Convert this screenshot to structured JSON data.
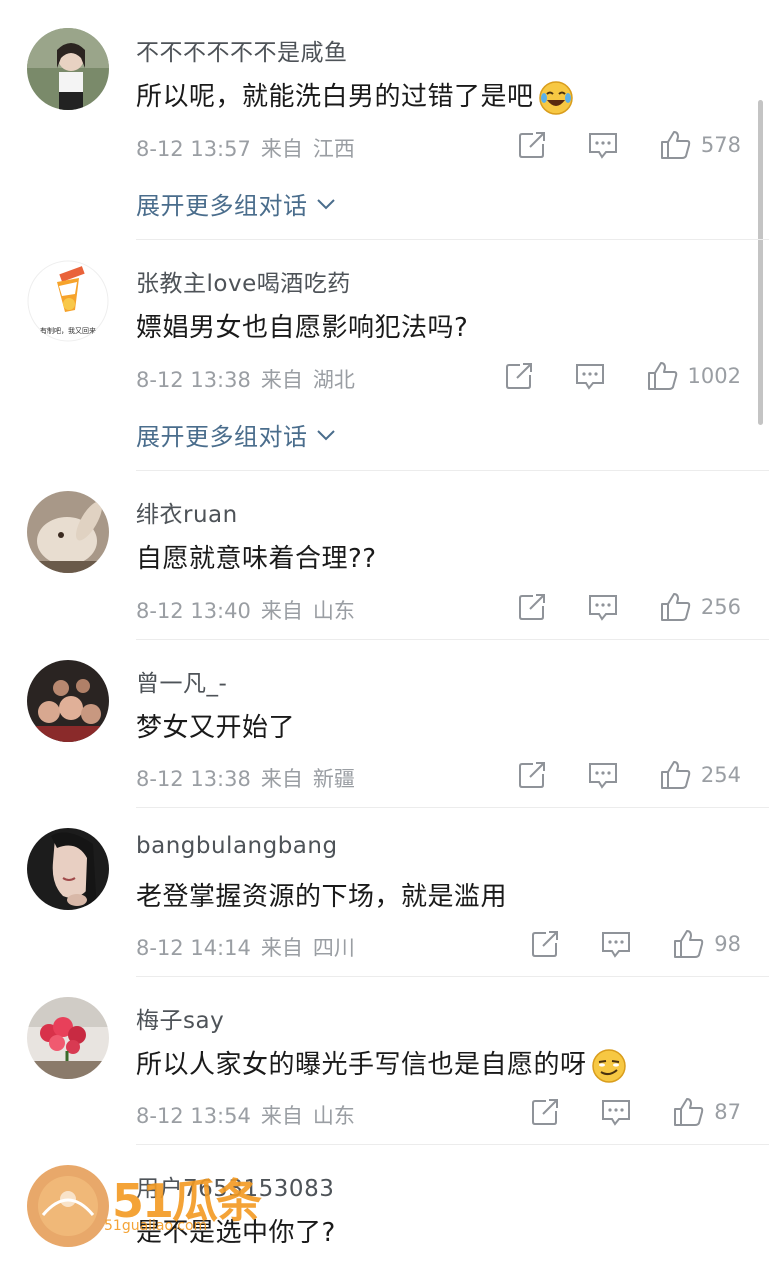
{
  "comments": [
    {
      "username": "不不不不不不是咸鱼",
      "content": "所以呢，就能洗白男的过错了是吧",
      "emoji": "laugh-cry-emoji",
      "date": "8-12 13:57",
      "from": "来自",
      "location": "江西",
      "likes": "578",
      "expand": "展开更多组对话"
    },
    {
      "username": "张教主love喝酒吃药",
      "content": "嫖娼男女也自愿影响犯法吗?",
      "date": "8-12 13:38",
      "from": "来自",
      "location": "湖北",
      "likes": "1002",
      "expand": "展开更多组对话"
    },
    {
      "username": "绯衣ruan",
      "content": "自愿就意味着合理??",
      "date": "8-12 13:40",
      "from": "来自",
      "location": "山东",
      "likes": "256"
    },
    {
      "username": "曾一凡_-",
      "content": "梦女又开始了",
      "date": "8-12 13:38",
      "from": "来自",
      "location": "新疆",
      "likes": "254"
    },
    {
      "username": "bangbulangbang",
      "content": "老登掌握资源的下场，就是滥用",
      "date": "8-12 14:14",
      "from": "来自",
      "location": "四川",
      "likes": "98"
    },
    {
      "username": "梅子say",
      "content": "所以人家女的曝光手写信也是自愿的呀",
      "emoji": "smirk-emoji",
      "date": "8-12 13:54",
      "from": "来自",
      "location": "山东",
      "likes": "87"
    },
    {
      "username": "用户7653153083",
      "content": "是不是选中你了?"
    }
  ],
  "avatar2_caption": "有制吧，我又回来",
  "watermark": {
    "brand": "51瓜条",
    "url": "51gualiao.com"
  },
  "colors": {
    "username": "#4e5358",
    "content": "#1a1a1a",
    "meta": "#9a9ea3",
    "link": "#4a6d8c",
    "watermark": "#f39a22"
  }
}
